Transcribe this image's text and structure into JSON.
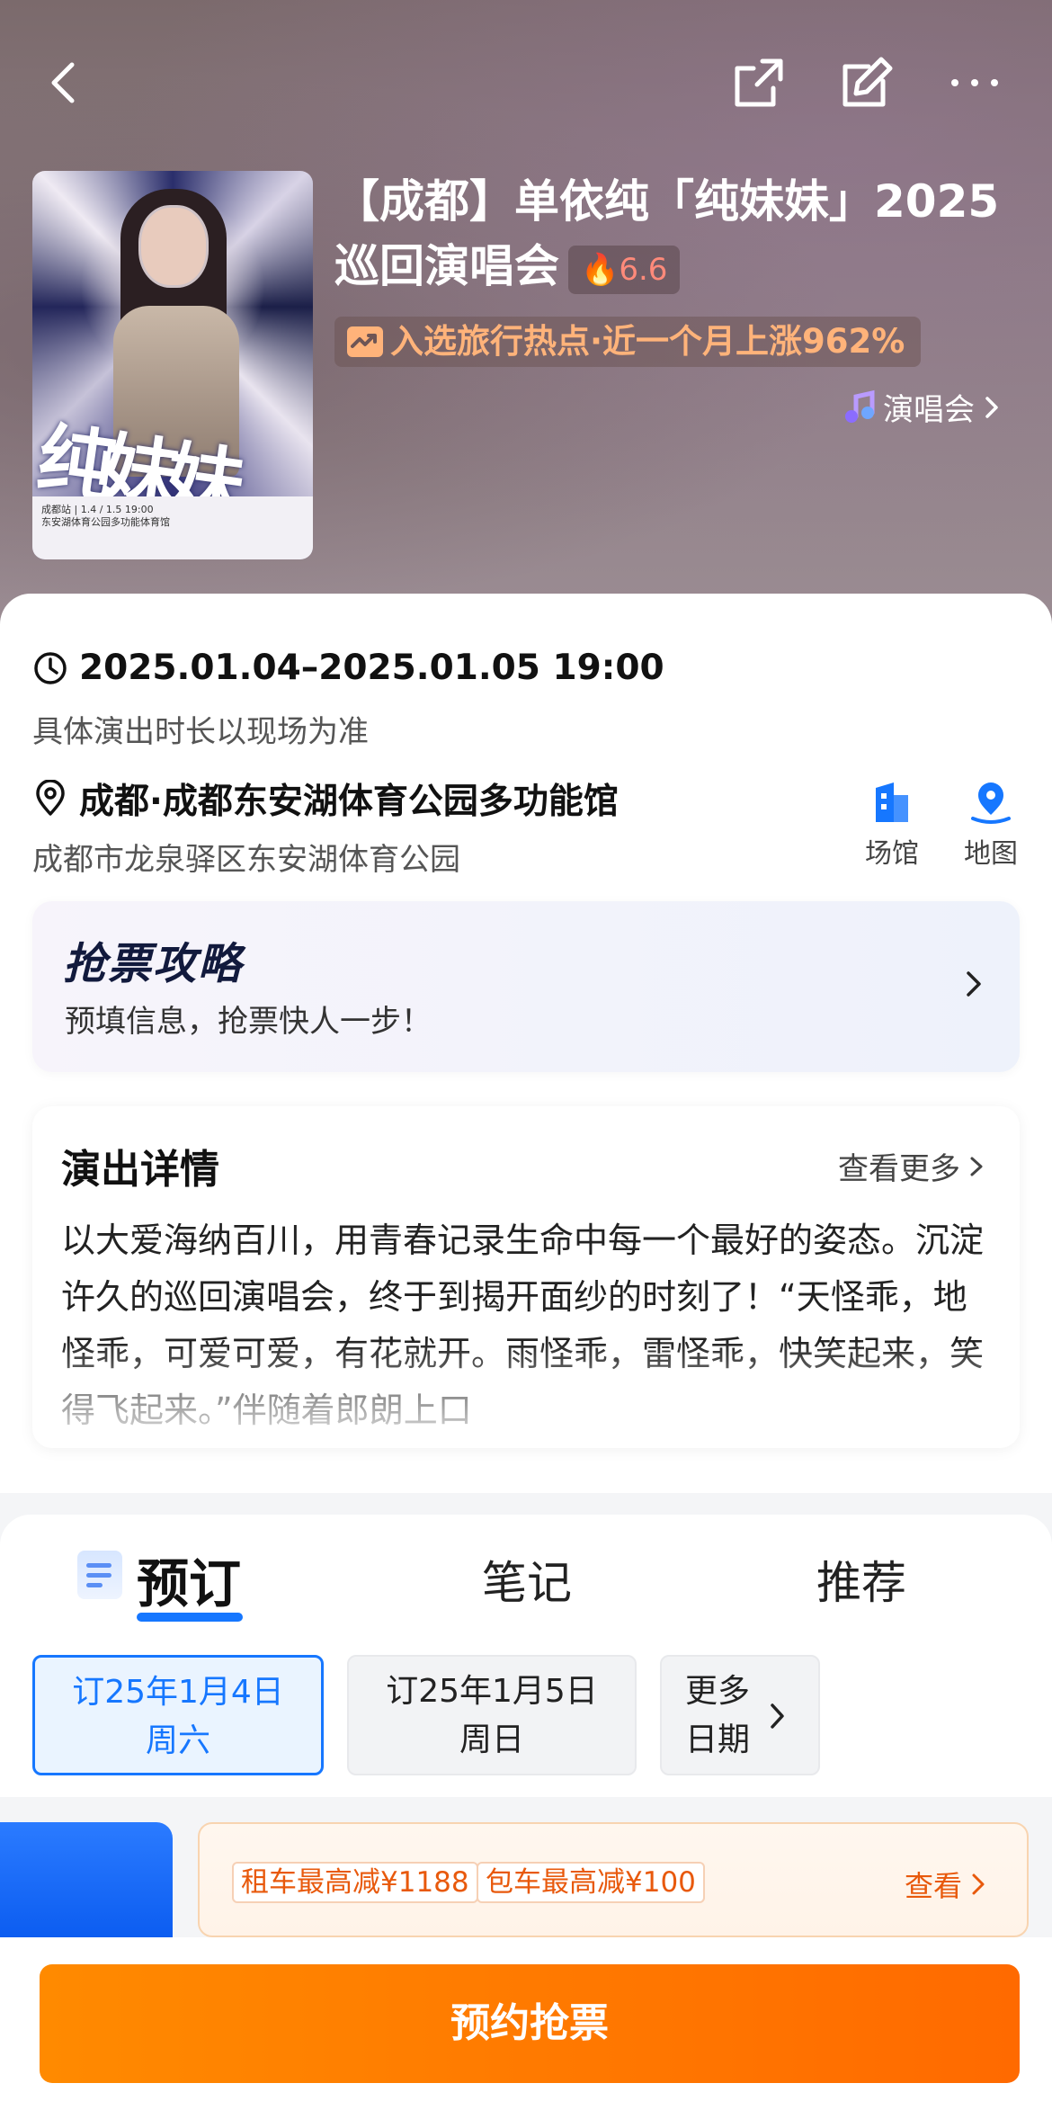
{
  "header": {
    "title": "【成都】单依纯「纯妹妹」2025巡回演唱会",
    "heat_score": "6.6",
    "trend_text": "入选旅行热点·近一个月上涨962%",
    "category": "演唱会"
  },
  "poster": {
    "title_art": "纯妹妹",
    "band_line1": "成都站 | 1.4 / 1.5 19:00",
    "band_line2": "东安湖体育公园多功能体育馆"
  },
  "event": {
    "datetime": "2025.01.04–2025.01.05 19:00",
    "duration_note": "具体演出时长以现场为准",
    "venue_name": "成都·成都东安湖体育公园多功能馆",
    "venue_address": "成都市龙泉驿区东安湖体育公园",
    "venue_button": "场馆",
    "map_button": "地图"
  },
  "strategy": {
    "title": "抢票攻略",
    "subtitle": "预填信息，抢票快人一步！"
  },
  "detail": {
    "title": "演出详情",
    "more": "查看更多",
    "text": "以大爱海纳百川，用青春记录生命中每一个最好的姿态。沉淀许久的巡回演唱会，终于到揭开面纱的时刻了！“天怪乖，地怪乖，可爱可爱，有花就开。雨怪乖，雷怪乖，快笑起来，笑得飞起来。”伴随着郎朗上口"
  },
  "tabs": [
    {
      "label": "预订",
      "active": true
    },
    {
      "label": "笔记",
      "active": false
    },
    {
      "label": "推荐",
      "active": false
    }
  ],
  "dates": [
    {
      "line1": "订25年1月4日",
      "line2": "周六",
      "selected": true
    },
    {
      "line1": "订25年1月5日",
      "line2": "周日",
      "selected": false
    },
    {
      "line1": "更多",
      "line2": "日期",
      "selected": false
    }
  ],
  "promo": {
    "tag1": "租车最高减¥1188",
    "tag2": "包车最高减¥100",
    "view": "查看"
  },
  "cta": {
    "label": "预约抢票"
  },
  "colors": {
    "accent": "#1677ff",
    "cta": "#ff7a00",
    "promo": "#e8590c"
  }
}
